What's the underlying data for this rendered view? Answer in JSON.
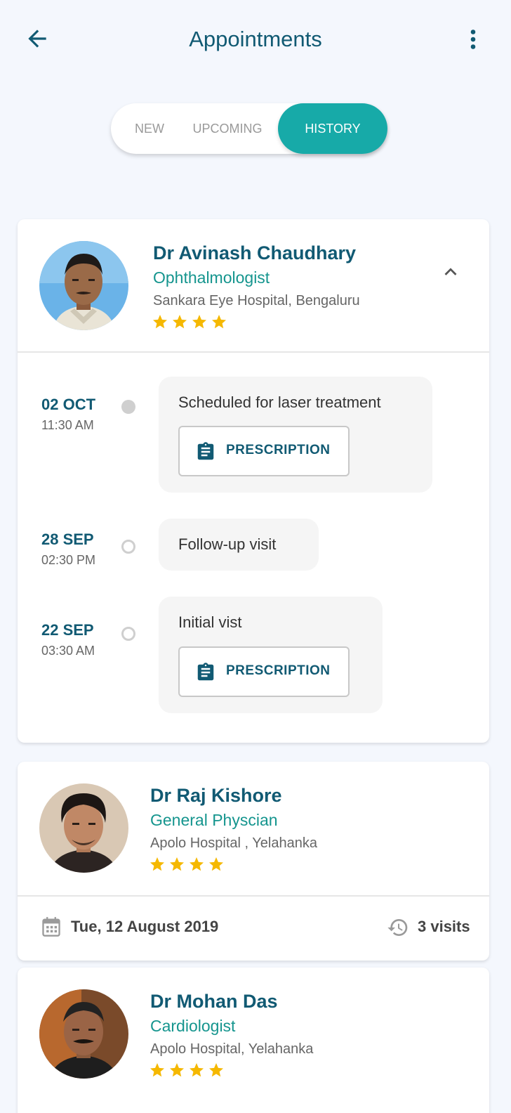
{
  "header": {
    "title": "Appointments",
    "back_icon": "arrow-left-icon",
    "menu_icon": "more-vert-icon"
  },
  "tabs": [
    {
      "label": "NEW",
      "active": false
    },
    {
      "label": "UPCOMING",
      "active": false
    },
    {
      "label": "HISTORY",
      "active": true
    }
  ],
  "colors": {
    "primary": "#115a73",
    "accent": "#17aaa8",
    "specialty": "#15958e",
    "star": "#f5b800",
    "background": "#f4f7fd"
  },
  "doctors": [
    {
      "name": "Dr Avinash Chaudhary",
      "specialty": "Ophthalmologist",
      "hospital": "Sankara Eye Hospital, Bengaluru",
      "rating": 4,
      "expanded": true,
      "timeline": [
        {
          "date": "02 OCT",
          "time": "11:30 AM",
          "note": "Scheduled for laser treatment",
          "has_prescription": true,
          "button_label": "PRESCRIPTION",
          "dot": "filled"
        },
        {
          "date": "28 SEP",
          "time": "02:30 PM",
          "note": "Follow-up visit",
          "has_prescription": false,
          "dot": "hollow"
        },
        {
          "date": "22 SEP",
          "time": "03:30 AM",
          "note": "Initial vist",
          "has_prescription": true,
          "button_label": "PRESCRIPTION",
          "dot": "hollow"
        }
      ]
    },
    {
      "name": "Dr Raj Kishore",
      "specialty": "General Physcian",
      "hospital": "Apolo Hospital , Yelahanka",
      "rating": 4,
      "expanded": false,
      "last_visit": "Tue, 12 August 2019",
      "visits": "3 visits"
    },
    {
      "name": "Dr Mohan Das",
      "specialty": "Cardiologist",
      "hospital": "Apolo Hospital, Yelahanka",
      "rating": 4,
      "expanded": false
    }
  ]
}
